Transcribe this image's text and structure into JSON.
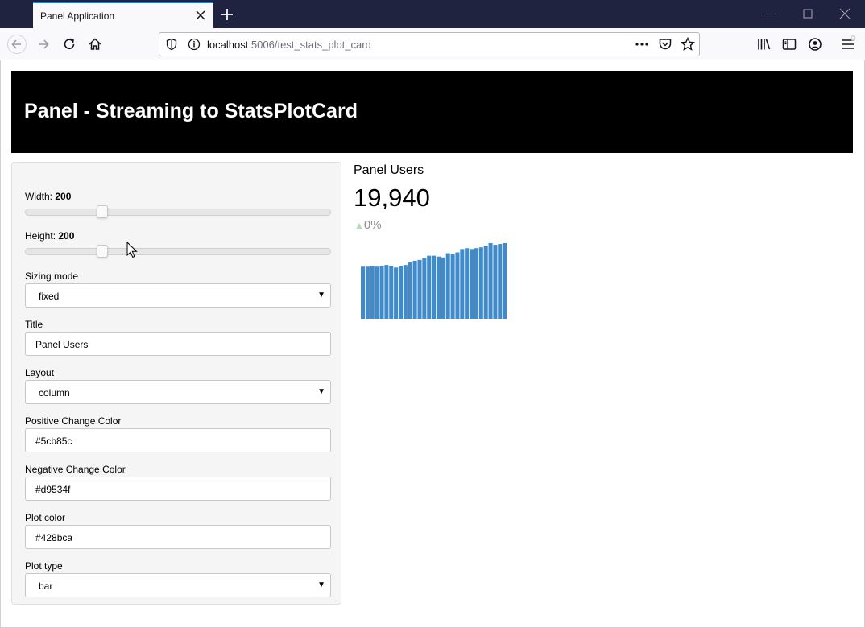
{
  "browser": {
    "tab_title": "Panel Application",
    "url_host": "localhost",
    "url_path": ":5006/test_stats_plot_card"
  },
  "header": {
    "title": "Panel - Streaming to StatsPlotCard"
  },
  "controls": {
    "width_label": "Width: ",
    "width_value": "200",
    "width_fraction": 0.25,
    "height_label": "Height: ",
    "height_value": "200",
    "height_fraction": 0.25,
    "sizing_mode_label": "Sizing mode",
    "sizing_mode_value": "fixed",
    "title_label": "Title",
    "title_value": "Panel Users",
    "layout_label": "Layout",
    "layout_value": "column",
    "pos_color_label": "Positive Change Color",
    "pos_color_value": "#5cb85c",
    "neg_color_label": "Negative Change Color",
    "neg_color_value": "#d9534f",
    "plot_color_label": "Plot color",
    "plot_color_value": "#428bca",
    "plot_type_label": "Plot type",
    "plot_type_value": "bar"
  },
  "card": {
    "title": "Panel Users",
    "value": "19,940",
    "change": "0%",
    "change_arrow": "▲"
  },
  "chart_data": {
    "type": "bar",
    "color": "#428bca",
    "values": [
      62,
      62,
      63,
      62,
      63,
      64,
      63,
      61,
      63,
      64,
      67,
      69,
      70,
      72,
      75,
      75,
      74,
      73,
      78,
      77,
      79,
      83,
      84,
      83,
      84,
      85,
      87,
      90,
      88,
      89,
      90
    ]
  },
  "icons": {
    "back": "arrow-left-icon",
    "forward": "arrow-right-icon",
    "reload": "reload-icon",
    "home": "home-icon"
  }
}
